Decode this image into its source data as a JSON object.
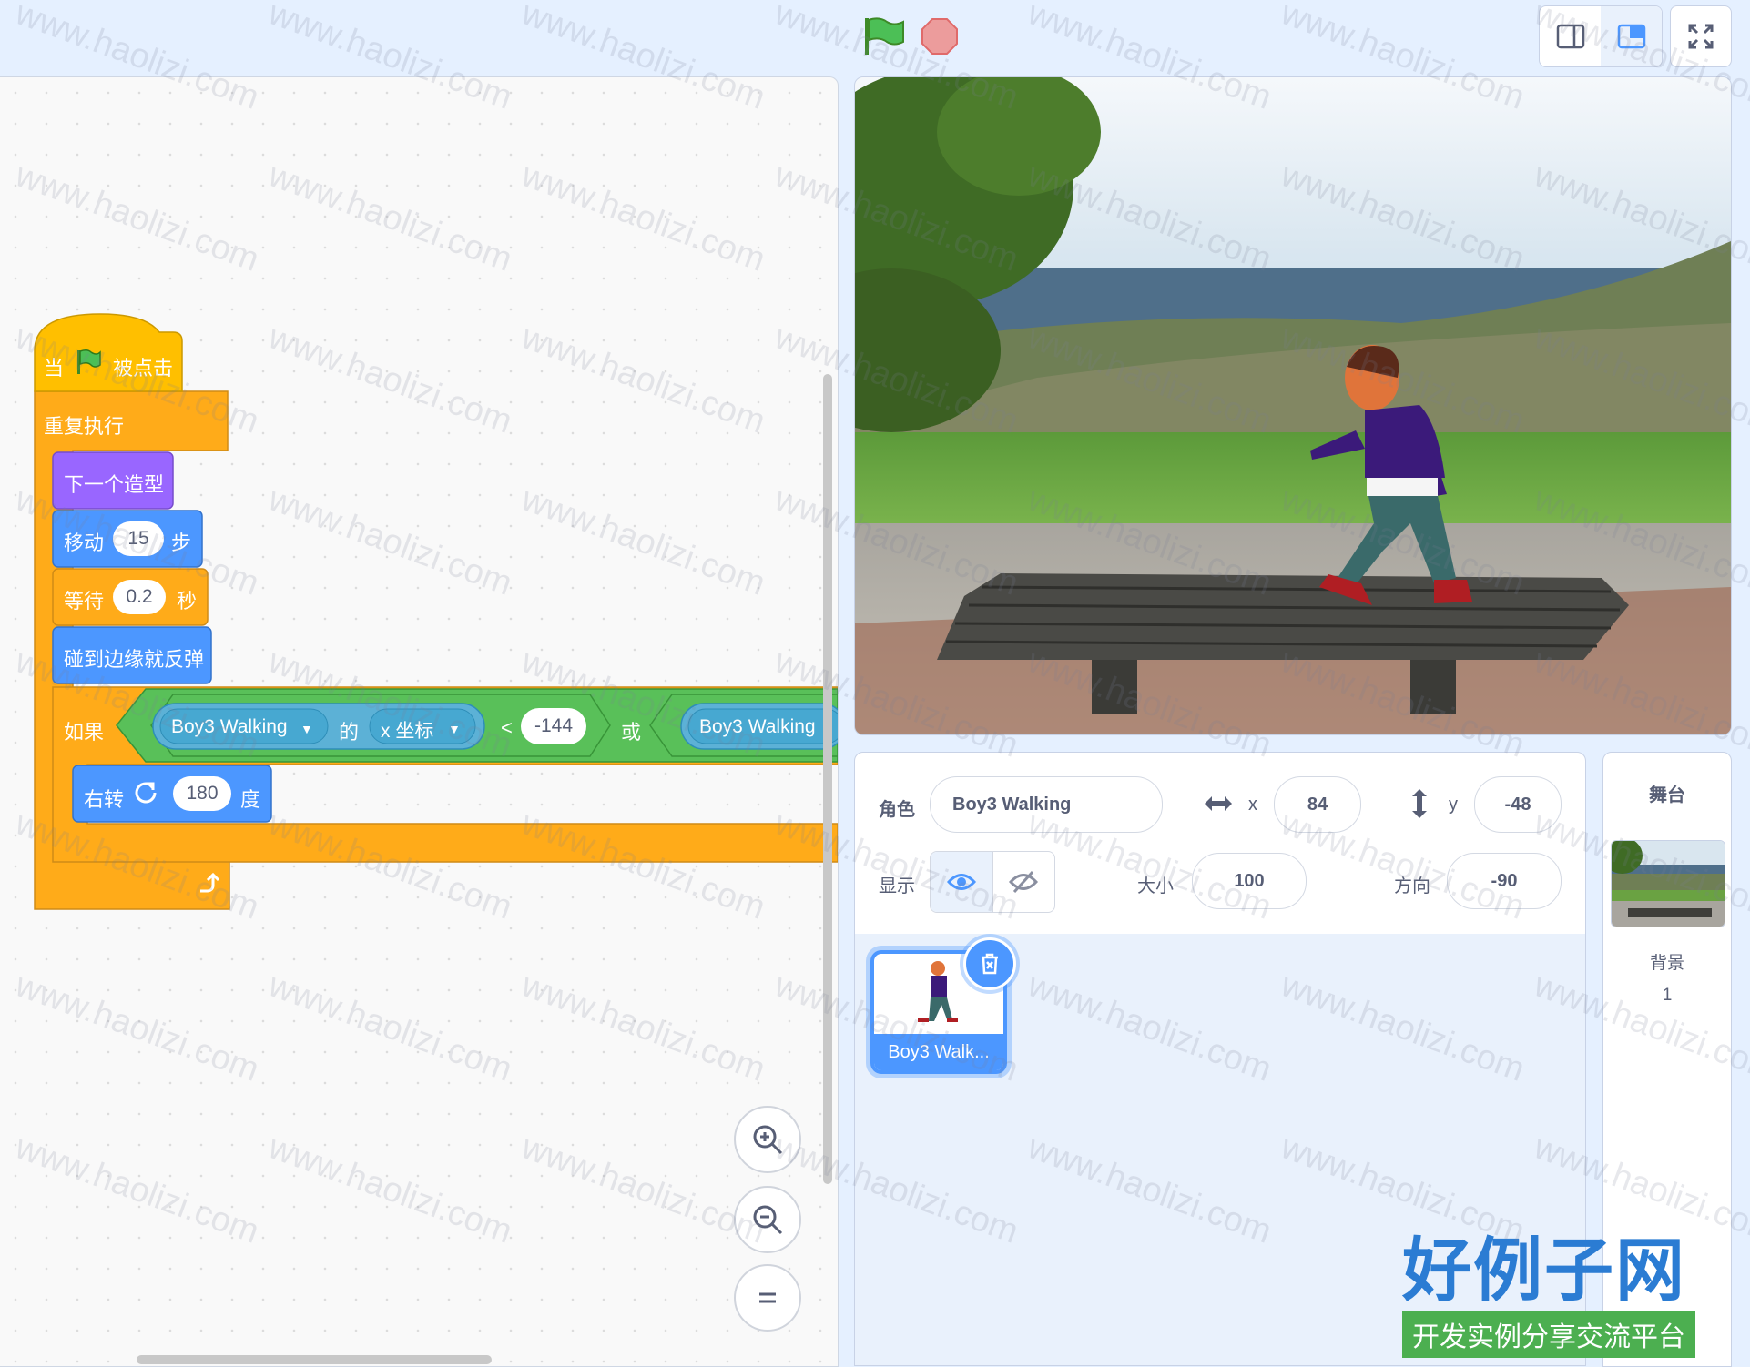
{
  "toolbar": {
    "green_flag_icon": "green-flag-icon",
    "stop_icon": "stop-icon",
    "small_stage_icon": "small-stage-icon",
    "normal_stage_icon": "normal-stage-icon",
    "fullscreen_icon": "fullscreen-icon"
  },
  "script": {
    "hat_when": "当",
    "hat_clicked": "被点击",
    "forever": "重复执行",
    "next_costume": "下一个造型",
    "move_label": "移动",
    "move_value": "15",
    "move_unit": "步",
    "wait_label": "等待",
    "wait_value": "0.2",
    "wait_unit": "秒",
    "bounce": "碰到边缘就反弹",
    "if_label": "如果",
    "sensing_sprite": "Boy3 Walking",
    "of_label": "的",
    "sensing_attr": "x 坐标",
    "lt_op": "<",
    "compare_value": "-144",
    "or_label": "或",
    "sensing_sprite_2": "Boy3 Walking",
    "turn_label": "右转",
    "turn_value": "180",
    "turn_unit": "度"
  },
  "sprite_info": {
    "sprite_label": "角色",
    "sprite_name": "Boy3 Walking",
    "x_label": "x",
    "x_value": "84",
    "y_label": "y",
    "y_value": "-48",
    "show_label": "显示",
    "size_label": "大小",
    "size_value": "100",
    "direction_label": "方向",
    "direction_value": "-90"
  },
  "sprites": [
    {
      "name": "Boy3 Walk..."
    }
  ],
  "stage_panel": {
    "title": "舞台",
    "backdrop_label": "背景",
    "backdrop_count": "1"
  },
  "branding": {
    "site": "好例子网",
    "tagline": "开发实例分享交流平台",
    "watermark": "www.haolizi.com"
  },
  "colors": {
    "events": "#ffbf00",
    "control": "#ffab19",
    "looks": "#9966ff",
    "motion": "#4c97ff",
    "operators": "#59c059",
    "sensing": "#5cb1d6"
  }
}
